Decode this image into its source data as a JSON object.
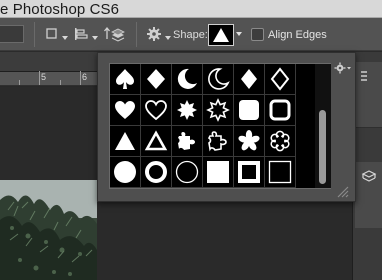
{
  "window": {
    "title": "e Photoshop CS6"
  },
  "options_bar": {
    "shape_label": "Shape:",
    "align_edges_label": "Align Edges",
    "align_edges_checked": false,
    "selected_shape": "triangle-filled"
  },
  "ruler": {
    "labels": [
      "5",
      "6"
    ]
  },
  "shape_picker": {
    "shapes": [
      "spade",
      "diamond-filled",
      "crescent-filled",
      "crescent-outline",
      "diamond-filled",
      "diamond-outline",
      "heart-filled",
      "heart-outline",
      "starburst-filled",
      "starburst-outline",
      "rounded-square-filled",
      "rounded-square-outline",
      "triangle-filled",
      "triangle-outline",
      "puzzle-filled",
      "puzzle-outline",
      "flower-filled",
      "flower-outline",
      "circle-filled",
      "circle-thick-outline",
      "circle-thin-outline",
      "square-filled",
      "square-thick-outline",
      "square-thin-outline"
    ]
  }
}
